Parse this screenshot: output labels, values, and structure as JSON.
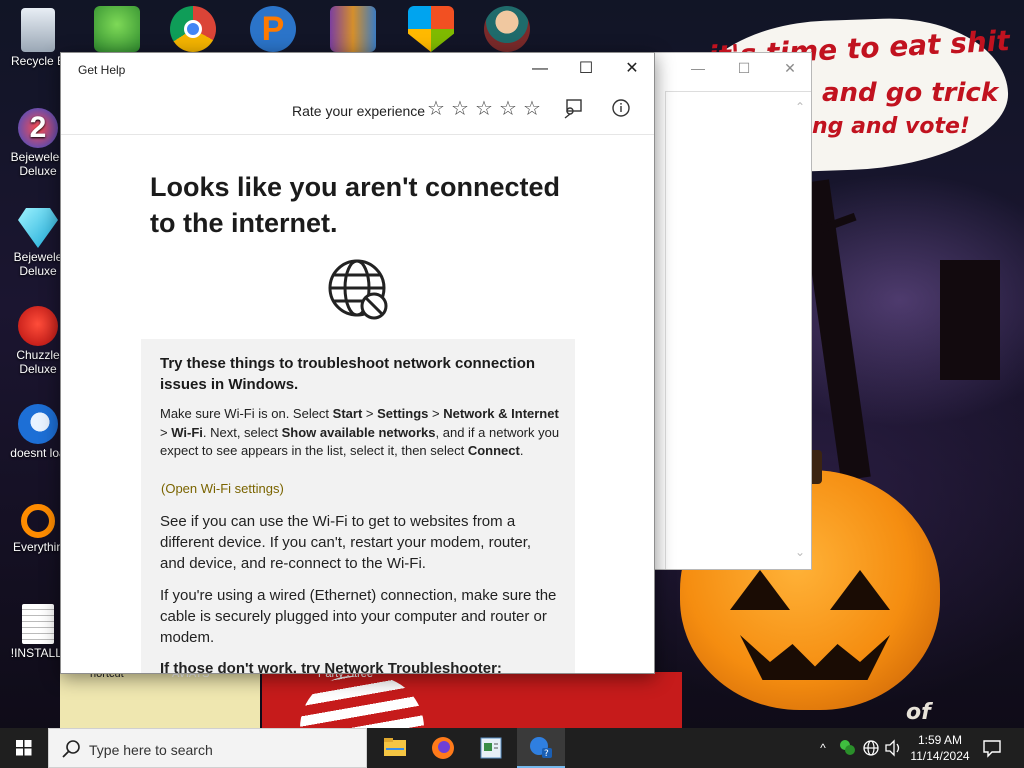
{
  "desktop": {
    "icons_left": [
      {
        "label": "Recycle B",
        "icon": "recycle-bin-icon"
      },
      {
        "label": "Bejewelec\nDeluxe",
        "icon": "bejeweled-2-icon"
      },
      {
        "label": "Bejewele\nDeluxe",
        "icon": "bejeweled-diamond-icon"
      },
      {
        "label": "Chuzzle\nDeluxe",
        "icon": "chuzzle-icon"
      },
      {
        "label": "doesnt loa",
        "icon": "thunderbird-icon"
      },
      {
        "label": "Everythin",
        "icon": "everything-search-icon"
      },
      {
        "label": "!INSTALLI",
        "icon": "text-file-icon"
      }
    ],
    "icons_top": [
      "messenger-icon",
      "chrome-icon",
      "pidgin-icon",
      "winrar-icon",
      "windows-security-icon",
      "game-character-icon"
    ],
    "bottom_labels": [
      "hortcut",
      "AVIATS",
      "Party Stree"
    ],
    "wallpaper_text": {
      "line1": "it's time to eat shit",
      "line2": "and go trick",
      "line3": "ng and vote!",
      "corner": "of"
    }
  },
  "back_window": {
    "minimize_glyph": "—",
    "maximize_glyph": "☐",
    "close_glyph": "✕",
    "scroll_up": "⌃",
    "scroll_down": "⌄"
  },
  "get_help": {
    "title": "Get Help",
    "minimize_glyph": "—",
    "maximize_glyph": "☐",
    "close_glyph": "✕",
    "rate_label": "Rate your experience",
    "stars": [
      "☆",
      "☆",
      "☆",
      "☆",
      "☆"
    ],
    "heading": "Looks like you aren't connected to the internet.",
    "panel": {
      "title": "Try these things to troubleshoot network connection issues in Windows.",
      "p1_a": "Make sure Wi-Fi is on. Select ",
      "p1_b1": "Start",
      "p1_c": " > ",
      "p1_b2": "Settings",
      "p1_d": " > ",
      "p1_b3": "Network & Internet",
      "p1_e": " > ",
      "p1_b4": "Wi-Fi",
      "p1_f": ". Next, select ",
      "p1_b5": "Show available networks",
      "p1_g": ", and if a network you expect to see appears in the list, select it, then select ",
      "p1_b6": "Connect",
      "p1_h": ".",
      "wifi_link": "(Open Wi-Fi settings)",
      "p2": "See if you can use the Wi-Fi to get to websites from a different device. If you can't, restart your modem, router, and device, and re-connect to the Wi-Fi.",
      "p3": "If you're using a wired (Ethernet) connection, make sure the cable is securely plugged into your computer and router or modem.",
      "p4": "If those don't work, try Network Troubleshooter:"
    }
  },
  "taskbar": {
    "search_placeholder": "Type here to search",
    "apps": [
      "file-explorer-icon",
      "firefox-icon",
      "notepad-icon",
      "get-help-icon"
    ],
    "tray_chevron": "^",
    "clock_time": "1:59 AM",
    "clock_date": "11/14/2024"
  },
  "colors": {
    "accent": "#76b9ed",
    "wifi_link": "#7a6400",
    "wallpaper_text": "#c1121f",
    "taskbar": "#1f1f1f"
  }
}
